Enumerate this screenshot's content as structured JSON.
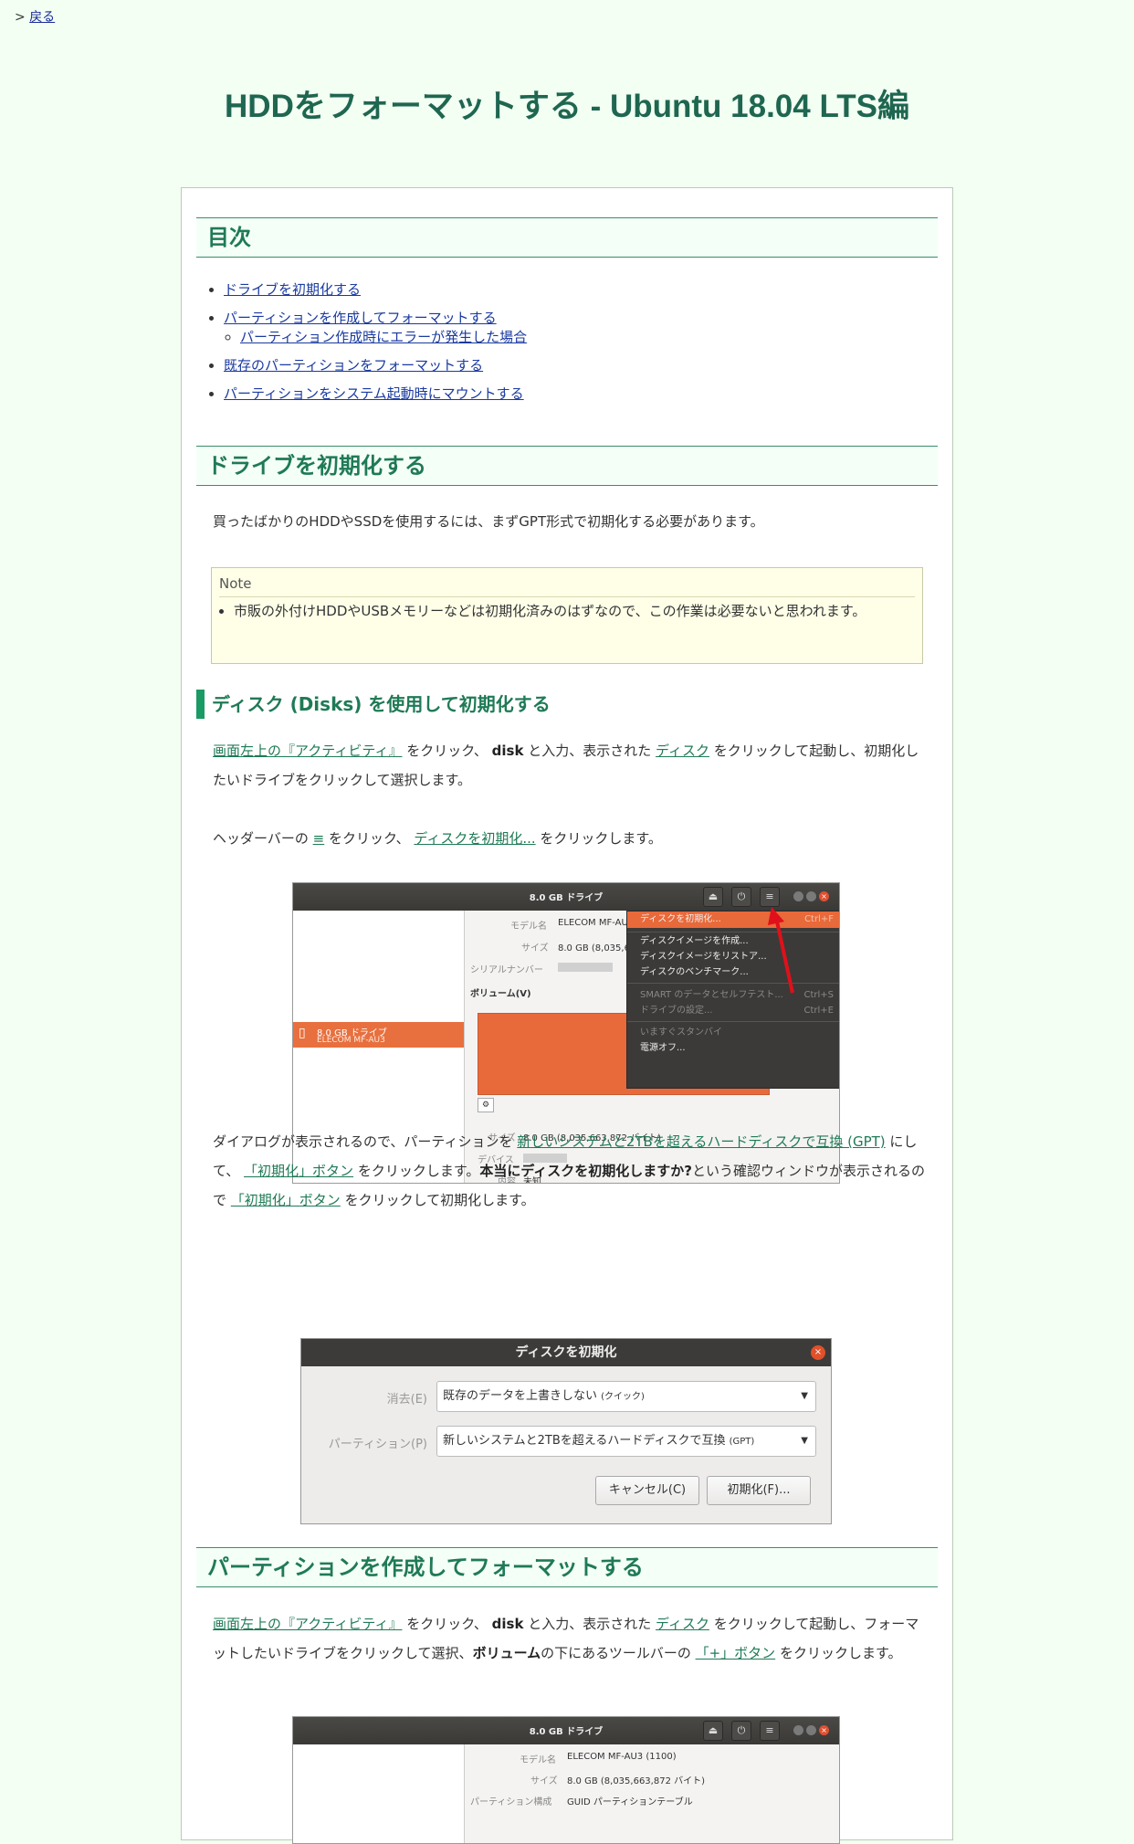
{
  "nav": {
    "prefix": ">",
    "back_label": "戻る"
  },
  "page_title": "HDDをフォーマットする - Ubuntu 18.04 LTS編",
  "toc": {
    "heading": "目次",
    "items": [
      "ドライブを初期化する",
      "パーティションを作成してフォーマットする",
      "パーティション作成時にエラーが発生した場合",
      "既存のパーティションをフォーマットする",
      "パーティションをシステム起動時にマウントする"
    ]
  },
  "section1": {
    "heading": "ドライブを初期化する",
    "intro": "買ったばかりのHDDやSSDを使用するには、まずGPT形式で初期化する必要があります。",
    "note_title": "Note",
    "note_text": "市販の外付けHDDやUSBメモリーなどは初期化済みのはずなので、この作業は必要ないと思われます。",
    "sub_heading": "ディスク (Disks) を使用して初期化する",
    "p1": {
      "link1": "画面左上の『アクティビティ』",
      "t1": " をクリック、",
      "b1": "disk",
      "t2": " と入力、表示された ",
      "link2": "ディスク",
      "t3": " をクリックして起動し、初期化したいドライブをクリックして選択します。"
    },
    "p2": {
      "t1": "ヘッダーバーの ",
      "link1": "≡",
      "t2": " をクリック、 ",
      "link2": "ディスクを初期化...",
      "t3": " をクリックします。"
    },
    "p3": {
      "t1": "ダイアログが表示されるので、パーティションを ",
      "link1": "新しいシステムと2TBを超えるハードディスクで互換 (GPT)",
      "t2": " にして、 ",
      "link2": "「初期化」ボタン",
      "t3": " をクリックします。",
      "b1": "本当にディスクを初期化しますか?",
      "t4": "という確認ウィンドウが表示されるので ",
      "link3": "「初期化」ボタン",
      "t5": " をクリックして初期化します。"
    }
  },
  "shot1": {
    "title": "8.0 GB ドライブ",
    "sidebar_item": "8.0 GB ドライブ",
    "sidebar_item_sub": "ELECOM MF-AU3",
    "model_label": "モデル名",
    "model_value": "ELECOM MF-AU3",
    "size_label": "サイズ",
    "size_value": "8.0 GB (8,035,663,872 バイト)",
    "serial_label": "シリアルナンバー",
    "volumes_label": "ボリューム(V)",
    "size2_label": "サイズ",
    "size2_value": "8.0 GB (8,035,663,872 バイト)",
    "device_label": "デバイス",
    "content_label": "内容",
    "content_value": "未知",
    "menu": [
      {
        "label": "ディスクを初期化...",
        "shortcut": "Ctrl+F"
      },
      {
        "label": "ディスクイメージを作成..."
      },
      {
        "label": "ディスクイメージをリストア..."
      },
      {
        "label": "ディスクのベンチマーク..."
      },
      {
        "label": "SMART のデータとセルフテスト...",
        "shortcut": "Ctrl+S"
      },
      {
        "label": "ドライブの設定...",
        "shortcut": "Ctrl+E"
      },
      {
        "label": "いますぐスタンバイ"
      },
      {
        "label": "電源オフ..."
      }
    ]
  },
  "dialog": {
    "title": "ディスクを初期化",
    "erase_label": "消去(E)",
    "erase_value": "既存のデータを上書きしない",
    "erase_value_small": "(クイック)",
    "partition_label": "パーティション(P)",
    "partition_value": "新しいシステムと2TBを超えるハードディスクで互換",
    "partition_value_small": "(GPT)",
    "cancel_label": "キャンセル(C)",
    "format_label": "初期化(F)..."
  },
  "section2": {
    "heading": "パーティションを作成してフォーマットする",
    "p1": {
      "link1": "画面左上の『アクティビティ』",
      "t1": " をクリック、",
      "b1": "disk",
      "t2": " と入力、表示された ",
      "link2": "ディスク",
      "t3": " をクリックして起動し、フォーマットしたいドライブをクリックして選択、",
      "b2": "ボリューム",
      "t4": "の下にあるツールバーの ",
      "link3": "「+」ボタン",
      "t5": " をクリックします。"
    }
  },
  "shot3": {
    "title": "8.0 GB ドライブ",
    "model_label": "モデル名",
    "model_value": "ELECOM MF-AU3 (1100)",
    "size_label": "サイズ",
    "size_value": "8.0 GB (8,035,663,872 バイト)",
    "ptable_label": "パーティション構成",
    "ptable_value": "GUID パーティションテーブル"
  }
}
